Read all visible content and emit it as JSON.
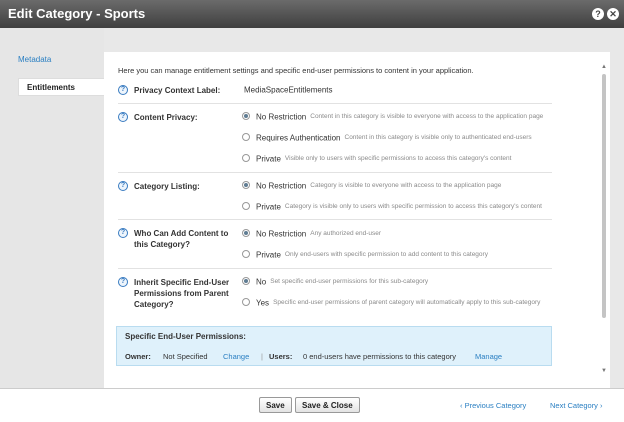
{
  "dialog": {
    "title": "Edit Category - Sports",
    "help_icon": "?",
    "close_icon": "✕"
  },
  "sidebar": {
    "items": [
      {
        "label": "Metadata"
      },
      {
        "label": "Entitlements"
      }
    ]
  },
  "main": {
    "intro": "Here you can manage entitlement settings and specific end-user permissions to content in your application.",
    "privacy_context": {
      "label": "Privacy Context Label:",
      "value": "MediaSpaceEntitlements"
    },
    "content_privacy": {
      "label": "Content Privacy:",
      "options": [
        {
          "name": "No Restriction",
          "desc": "Content in this category is visible to everyone with access to the application page"
        },
        {
          "name": "Requires Authentication",
          "desc": "Content in this category is visible only to authenticated end-users"
        },
        {
          "name": "Private",
          "desc": "Visible only to users with specific permissions to access this category's content"
        }
      ]
    },
    "category_listing": {
      "label": "Category Listing:",
      "options": [
        {
          "name": "No Restriction",
          "desc": "Category is visible to everyone with access to the application page"
        },
        {
          "name": "Private",
          "desc": "Category is visible only to users with specific permission to access this category's content"
        }
      ]
    },
    "add_content": {
      "label_line1": "Who Can Add Content to",
      "label_line2": "this Category?",
      "options": [
        {
          "name": "No Restriction",
          "desc": "Any authorized end-user"
        },
        {
          "name": "Private",
          "desc": "Only end-users with specific permission to add content to this category"
        }
      ]
    },
    "inherit": {
      "label_line1": "Inherit Specific End-User",
      "label_line2": "Permissions from Parent",
      "label_line3": "Category?",
      "options": [
        {
          "name": "No",
          "desc": "Set specific end-user permissions for this sub-category"
        },
        {
          "name": "Yes",
          "desc": "Specific end-user permissions of parent category will automatically apply to this sub-category"
        }
      ]
    },
    "permissions": {
      "header": "Specific End-User Permissions:",
      "owner_label": "Owner:",
      "owner_value": "Not Specified",
      "change_link": "Change",
      "users_label": "Users:",
      "users_value": "0 end-users have permissions to this category",
      "manage_link": "Manage"
    }
  },
  "footer": {
    "save": "Save",
    "save_close": "Save & Close",
    "previous": "Previous Category",
    "next": "Next Category"
  }
}
